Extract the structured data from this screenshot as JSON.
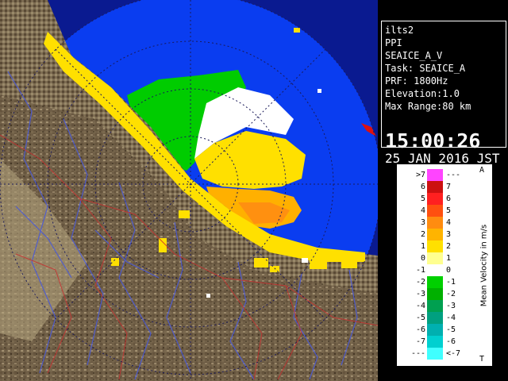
{
  "info": {
    "site": "ilts2",
    "mode": "PPI",
    "product": "SEAICE_A_V",
    "task": "Task: SEAICE_A",
    "prf": "PRF: 1800Hz",
    "elevation": "Elevation:1.0",
    "max_range": "Max Range:80 km",
    "time": "15:00:26",
    "date": "25 JAN 2016 JST"
  },
  "legend": {
    "title": "Mean Velocity in m/s",
    "top_mark": "A",
    "bottom_mark": "T",
    "rows": [
      {
        "left": ">7",
        "right": "---",
        "color": "#ff44ff"
      },
      {
        "left": "6",
        "right": "7",
        "color": "#cc1010"
      },
      {
        "left": "5",
        "right": "6",
        "color": "#ff2020"
      },
      {
        "left": "4",
        "right": "5",
        "color": "#ff5010"
      },
      {
        "left": "3",
        "right": "4",
        "color": "#ff8c10"
      },
      {
        "left": "2",
        "right": "3",
        "color": "#ffb400"
      },
      {
        "left": "1",
        "right": "2",
        "color": "#ffe000"
      },
      {
        "left": "0",
        "right": "1",
        "color": "#ffff90"
      },
      {
        "left": "-1",
        "right": "0",
        "color": "#ffffff"
      },
      {
        "left": "-2",
        "right": "-1",
        "color": "#00d000"
      },
      {
        "left": "-3",
        "right": "-2",
        "color": "#00b000"
      },
      {
        "left": "-4",
        "right": "-3",
        "color": "#00a050"
      },
      {
        "left": "-5",
        "right": "-4",
        "color": "#00a080"
      },
      {
        "left": "-6",
        "right": "-5",
        "color": "#00b0b0"
      },
      {
        "left": "-7",
        "right": "-6",
        "color": "#00d0d0"
      },
      {
        "left": "---",
        "right": "<-7",
        "color": "#40ffff"
      }
    ]
  },
  "colors": {
    "sea_radar": "#0a3df0",
    "out_of_range": "#0a1a90",
    "land": "#7a6a50",
    "coast_echo": "#ffe000"
  }
}
